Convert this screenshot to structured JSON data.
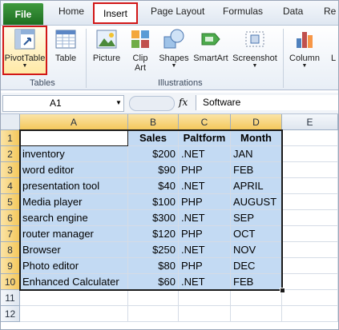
{
  "tabs": {
    "file": "File",
    "home": "Home",
    "insert": "Insert",
    "page_layout": "Page Layout",
    "formulas": "Formulas",
    "data": "Data",
    "review": "Re"
  },
  "ribbon": {
    "pivottable": "PivotTable",
    "table": "Table",
    "picture": "Picture",
    "clipart_line1": "Clip",
    "clipart_line2": "Art",
    "shapes": "Shapes",
    "smartart": "SmartArt",
    "screenshot": "Screenshot",
    "column": "Column",
    "next": "L",
    "group_tables": "Tables",
    "group_illustrations": "Illustrations"
  },
  "formula_bar": {
    "name_box": "A1",
    "fx": "fx",
    "content": "Software"
  },
  "grid": {
    "columns": [
      "A",
      "B",
      "C",
      "D",
      "E"
    ],
    "rows": [
      "1",
      "2",
      "3",
      "4",
      "5",
      "6",
      "7",
      "8",
      "9",
      "10",
      "11",
      "12"
    ],
    "header": [
      "Software",
      "Sales",
      "Paltform",
      "Month"
    ],
    "data": [
      [
        "inventory",
        "$200",
        ".NET",
        "JAN"
      ],
      [
        "word editor",
        "$90",
        "PHP",
        "FEB"
      ],
      [
        "presentation tool",
        "$40",
        ".NET",
        "APRIL"
      ],
      [
        "Media player",
        "$100",
        "PHP",
        "AUGUST"
      ],
      [
        "search engine",
        "$300",
        ".NET",
        "SEP"
      ],
      [
        "router manager",
        "$120",
        "PHP",
        "OCT"
      ],
      [
        "Browser",
        "$250",
        ".NET",
        "NOV"
      ],
      [
        "Photo editor",
        "$80",
        "PHP",
        "DEC"
      ],
      [
        "Enhanced Calculater",
        "$60",
        ".NET",
        "FEB"
      ]
    ]
  },
  "colors": {
    "highlight_red": "#d21717",
    "selection_fill": "#c3daf3",
    "file_tab": "#2a7d2e"
  },
  "icons": [
    "pivottable-icon",
    "table-icon",
    "picture-icon",
    "clipart-icon",
    "shapes-icon",
    "smartart-icon",
    "screenshot-icon",
    "column-chart-icon",
    "fx-icon"
  ]
}
